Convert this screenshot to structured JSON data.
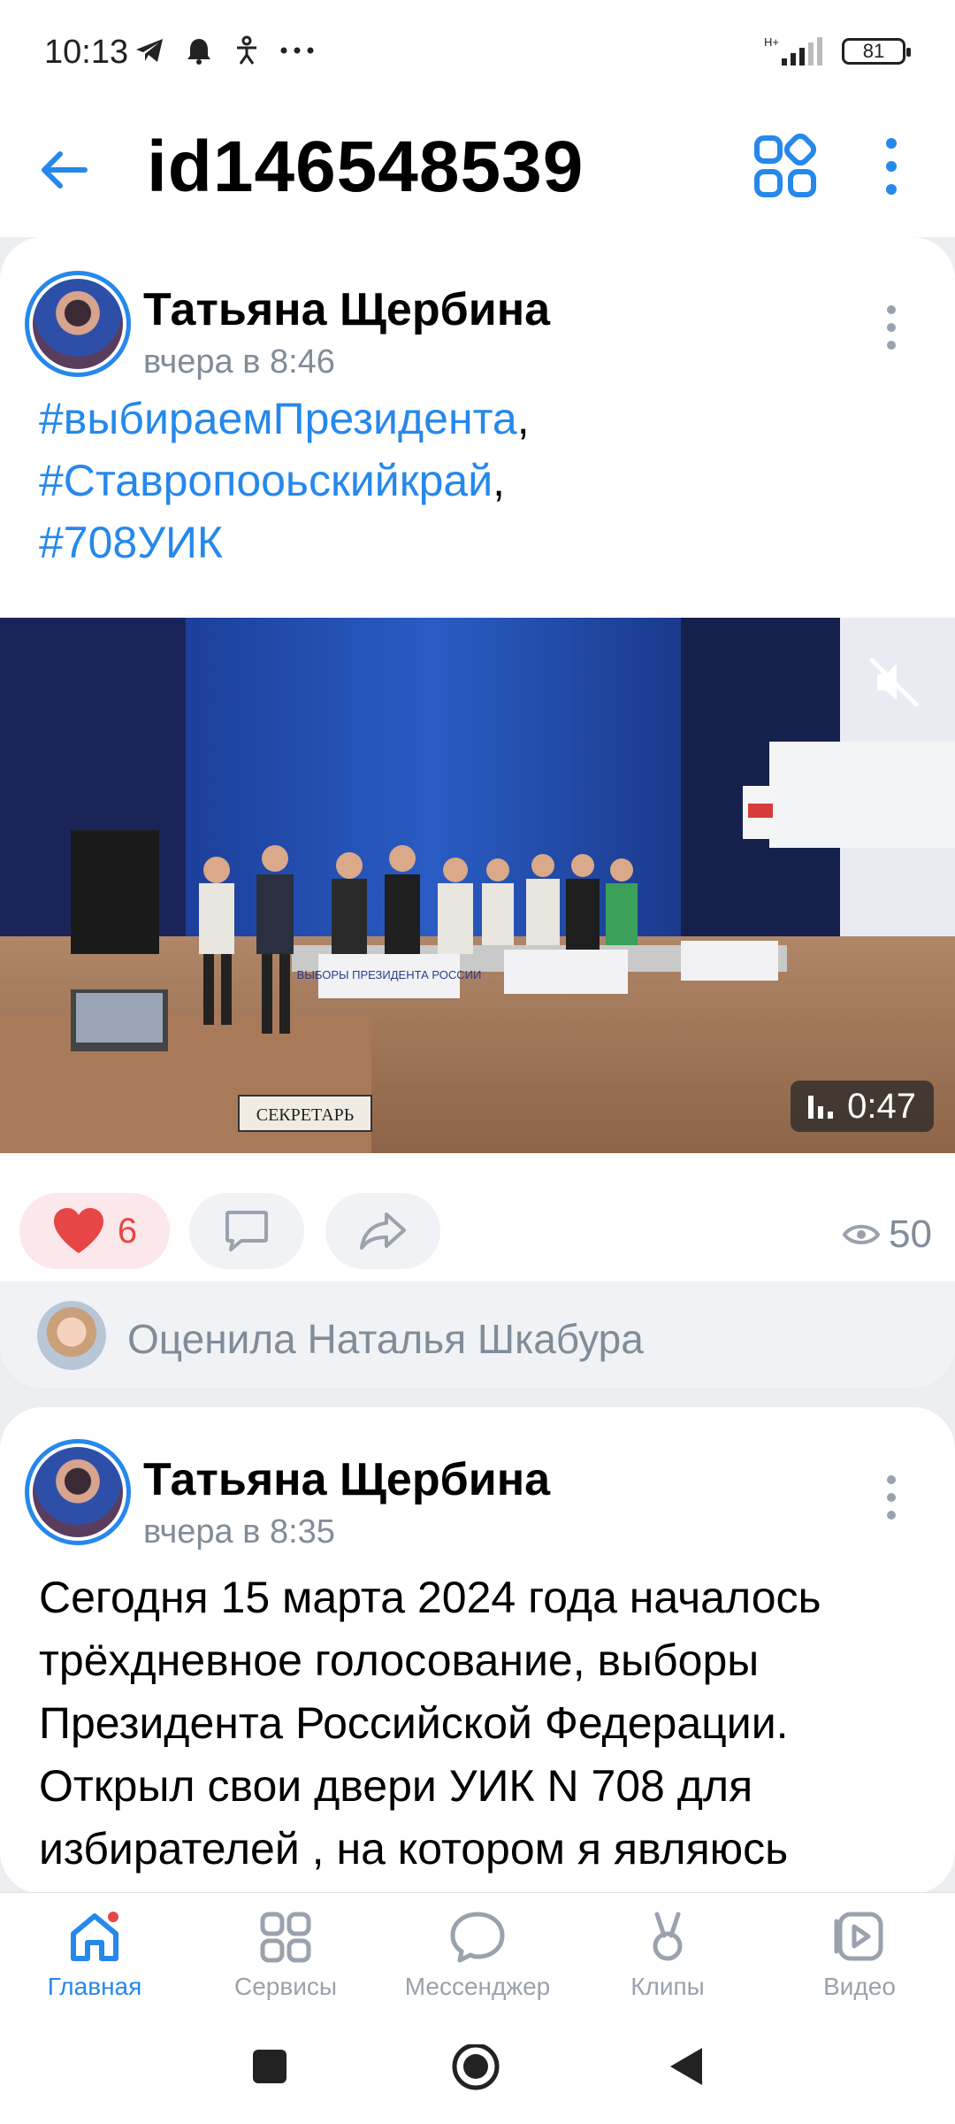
{
  "status_bar": {
    "time": "10:13",
    "icons": [
      "telegram-icon",
      "alarm-icon",
      "accessibility-icon",
      "more-dots-icon"
    ],
    "network": "H+",
    "battery": "81"
  },
  "header": {
    "title": "id146548539"
  },
  "post1": {
    "author": "Татьяна Щербина",
    "time": "вчера в 8:46",
    "tags": [
      "#выбираемПрезидента",
      "#Ставропооьскийкрай",
      "#708УИК"
    ],
    "video": {
      "duration": "0:47",
      "muted": true,
      "banner_text": "ВЫБОРЫ ПРЕЗИДЕНТА РОССИИ",
      "sign_text": "СЕКРЕТАРЬ"
    },
    "likes": "6",
    "views": "50",
    "liked_by": "Оценила Наталья Шкабура"
  },
  "post2": {
    "author": "Татьяна Щербина",
    "time": "вчера в 8:35",
    "text": "Сегодня 15 марта 2024 года началось трёхдневное голосование, выборы Президента Российской Федерации. Открыл свои двери УИК N 708 для избирателей , на котором я являюсь"
  },
  "tabbar": {
    "items": [
      {
        "label": "Главная",
        "icon": "home-icon",
        "active": true,
        "badge": true
      },
      {
        "label": "Сервисы",
        "icon": "services-icon",
        "active": false
      },
      {
        "label": "Мессенджер",
        "icon": "messenger-icon",
        "active": false
      },
      {
        "label": "Клипы",
        "icon": "clips-icon",
        "active": false
      },
      {
        "label": "Видео",
        "icon": "video-icon",
        "active": false
      }
    ]
  },
  "colors": {
    "accent": "#2688eb",
    "like": "#e64646",
    "secondary_text": "#818c99"
  }
}
